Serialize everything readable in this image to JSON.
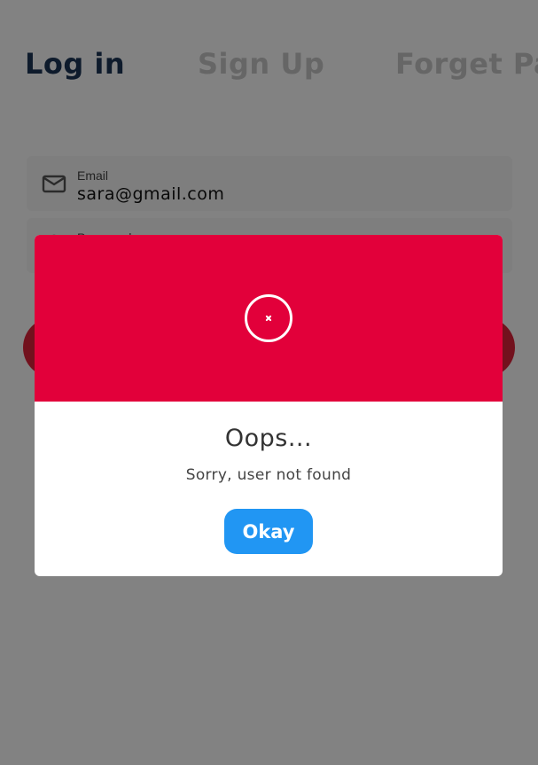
{
  "tabs": {
    "login": "Log in",
    "signup": "Sign Up",
    "forget": "Forget Password"
  },
  "form": {
    "email_label": "Email",
    "email_value": "sara@gmail.com",
    "password_label": "Password",
    "mail_icon": "mail-icon",
    "lock_icon": "lock-icon"
  },
  "dialog": {
    "icon": "error-x-icon",
    "title": "Oops...",
    "message": "Sorry, user not found",
    "confirm_label": "Okay"
  },
  "colors": {
    "accent_red": "#e2003a",
    "button_blue": "#2196f3",
    "active_tab": "#1d3557",
    "inactive_tab": "#c9c9c9"
  }
}
